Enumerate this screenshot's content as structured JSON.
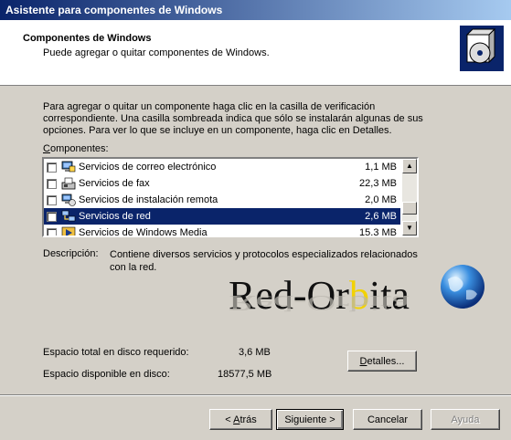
{
  "window": {
    "title": "Asistente para componentes de Windows"
  },
  "header": {
    "title": "Componentes de Windows",
    "subtitle": "Puede agregar o quitar componentes de Windows."
  },
  "instructions": "Para agregar o quitar un componente haga clic en la casilla de verificación correspondiente. Una casilla sombreada indica que sólo se instalarán algunas de sus opciones. Para ver lo que se incluye en un componente, haga clic en Detalles.",
  "components_label": {
    "accel": "C",
    "rest": "omponentes:"
  },
  "components": [
    {
      "name": "Servicios de correo electrónico",
      "size": "1,1 MB",
      "icon": "mail-server-icon",
      "checked": false,
      "selected": false
    },
    {
      "name": "Servicios de fax",
      "size": "22,3 MB",
      "icon": "fax-icon",
      "checked": false,
      "selected": false
    },
    {
      "name": "Servicios de instalación remota",
      "size": "2,0 MB",
      "icon": "remote-install-icon",
      "checked": false,
      "selected": false
    },
    {
      "name": "Servicios de red",
      "size": "2,6 MB",
      "icon": "network-services-icon",
      "checked": false,
      "selected": true
    },
    {
      "name": "Servicios de Windows Media",
      "size": "15,3 MB",
      "icon": "windows-media-icon",
      "checked": false,
      "selected": false
    }
  ],
  "description": {
    "label": "Descripción:",
    "text": "Contiene diversos servicios y protocolos especializados relacionados con la red."
  },
  "watermark": {
    "text_start": "Red-Or",
    "text_accent": "b",
    "text_end": "ita"
  },
  "disk": {
    "required_label": "Espacio total en disco requerido:",
    "required_value": "3,6 MB",
    "available_label": "Espacio disponible en disco:",
    "available_value": "18577,5 MB"
  },
  "buttons": {
    "details": {
      "accel": "D",
      "rest": "etalles..."
    },
    "back": {
      "prefix": "< ",
      "accel": "A",
      "rest": "trás"
    },
    "next": {
      "label": "Siguiente >"
    },
    "cancel": {
      "label": "Cancelar"
    },
    "help": {
      "label": "Ayuda"
    }
  },
  "colors": {
    "selection": "#0a246a",
    "dialog": "#d4d0c8",
    "logo_accent": "#f2d200"
  }
}
